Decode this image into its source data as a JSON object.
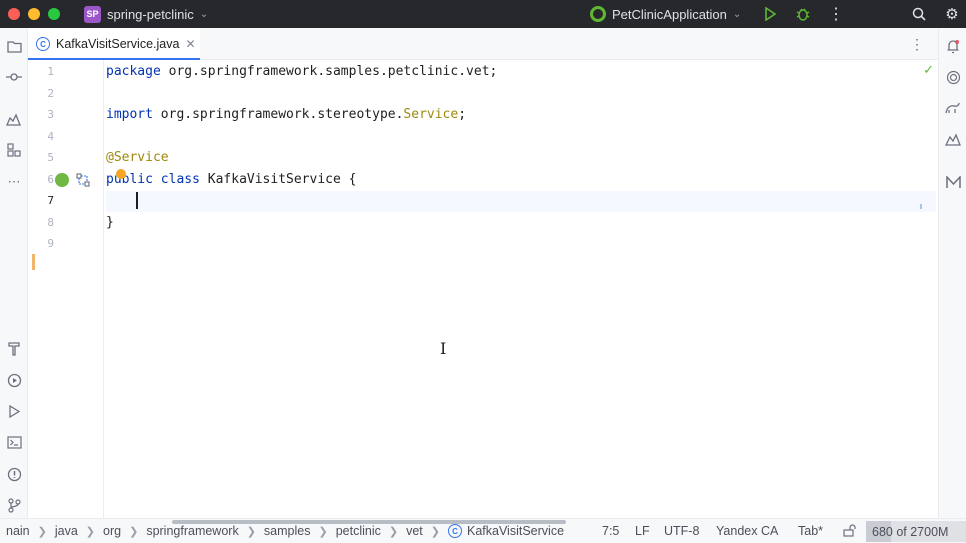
{
  "titlebar": {
    "project_badge": "SP",
    "project_name": "spring-petclinic",
    "run_config": "PetClinicApplication"
  },
  "tab": {
    "filename": "KafkaVisitService.java",
    "icon_letter": "C"
  },
  "editor": {
    "line_numbers": [
      "1",
      "2",
      "3",
      "4",
      "5",
      "6",
      "7",
      "8",
      "9"
    ],
    "current_line": 7,
    "code": {
      "l1_kw": "package",
      "l1_rest": " org.springframework.samples.petclinic.vet;",
      "l3_kw": "import",
      "l3_pkg": " org.springframework.stereotype.",
      "l3_cls": "Service",
      "l3_end": ";",
      "l5_ann": "@Service",
      "l6_kw1": "public",
      "l6_kw2": "class",
      "l6_name": " KafkaVisitService ",
      "l6_brace": "{",
      "l8_brace": "}"
    }
  },
  "statusbar": {
    "breadcrumbs": [
      "nain",
      "java",
      "org",
      "springframework",
      "samples",
      "petclinic",
      "vet",
      "KafkaVisitService"
    ],
    "position": "7:5",
    "line_ending": "LF",
    "encoding": "UTF-8",
    "vcs": "Yandex CA",
    "indent": "Tab*",
    "memory": "680 of 2700M",
    "memory_used_fraction": 0.25
  },
  "colors": {
    "accent": "#3574f0",
    "keyword": "#0033b3",
    "annotation": "#9e880d",
    "spring_green": "#5fb832"
  }
}
